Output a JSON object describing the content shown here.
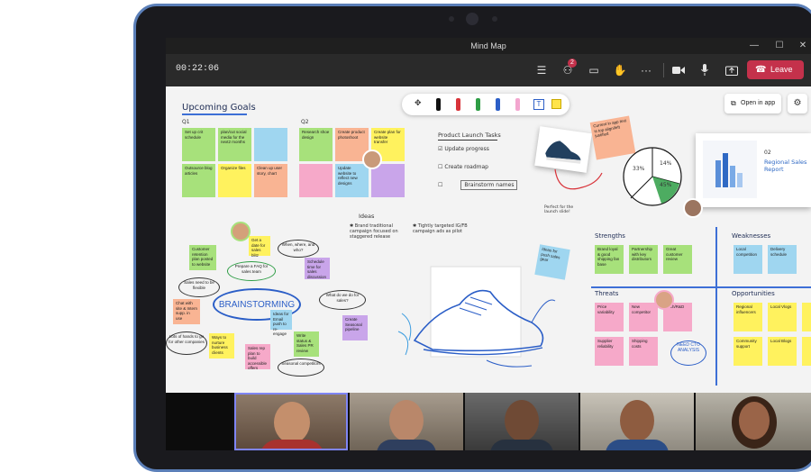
{
  "window": {
    "title": "Mind Map",
    "minimize": "—",
    "maximize": "☐",
    "close": "✕"
  },
  "toolbar": {
    "timer": "00:22:06",
    "badge_count": "2",
    "leave_label": "Leave"
  },
  "board": {
    "open_in_app": "Open in app",
    "goals": {
      "title": "Upcoming Goals",
      "q1": "Q1",
      "q2": "Q2",
      "q1_notes": [
        "Set up crit schedule",
        "plan/cut social media for the next2 months",
        "",
        "Outsource blog articles",
        "Organize files",
        "Clean up user story, chart"
      ],
      "q2_notes": [
        "Research shoe design",
        "Create product photoshoot",
        "Create plan for website transfer",
        "",
        "Update website to reflect new designs",
        ""
      ]
    },
    "tasks": {
      "title": "Product Launch Tasks",
      "items": [
        "Update progress",
        "Create roadmap",
        "Brainstorm names"
      ]
    },
    "ideas": {
      "title": "Ideas",
      "items": [
        "Brand traditional campaign focused on staggered release",
        "Tightly targeted IG/FB campaign ads as pilot"
      ]
    },
    "sticky_current": "Current in app text is top align/left justified",
    "shoe_caption": "Perfect for the launch slide!",
    "pie": {
      "labels": [
        "33%",
        "14%",
        "45%"
      ]
    },
    "report": {
      "number": "02",
      "title": "Regional Sales Report"
    },
    "brainstorm": {
      "center": "BRAINSTORMING",
      "notes": [
        "Customer retention plan posted to website",
        "Get a date for sales blitz",
        "Schedule time for sales discussion",
        "Chat with site & Intern supp. in use",
        "Ways to nurture business clients",
        "Sales rep plan to build accessible offers",
        "Write status & Sales PR review",
        "Create Seasonal pipeline",
        "Ideas for Email push to re-engage"
      ],
      "bubbles": [
        "Prepare a FAQ for sales team",
        "When, where, and who?",
        "Sales need to be flexible",
        "What do we do for sales?",
        "Lots of hands to go for other companies",
        "Seasonal competitors"
      ]
    },
    "swot": {
      "strengths": "Strengths",
      "weaknesses": "Weaknesses",
      "threats": "Threats",
      "opportunities": "Opportunities",
      "strength_notes": [
        "Brand loyal & good shipping fan base",
        "Partnership with key distributors",
        "Great customer review"
      ],
      "weakness_notes": [
        "Local competition",
        "Delivery schedule"
      ],
      "threat_notes": [
        "Price variability",
        "New competitor",
        "Tech/R&D",
        "Supplier reliability",
        "Shipping costs",
        ""
      ],
      "opportunity_notes": [
        "Regional influencers",
        "Local Vlogs",
        "",
        "Community support",
        "Local Blogs",
        ""
      ]
    },
    "need_analysis": "NEED CTO ANALYSIS",
    "blue_sticky": "Ideas for push sales gear"
  },
  "colors": {
    "leave_red": "#c4314b",
    "sticky_pink": "#f6a9c9",
    "sticky_yellow": "#fff25e",
    "sticky_green": "#a7e17b",
    "sticky_blue": "#9fd6f0",
    "sticky_purple": "#c9a5ea",
    "sticky_orange": "#f9b493",
    "ink_blue": "#3d6fd6"
  },
  "icons": [
    "list-icon",
    "people-icon",
    "chat-icon",
    "raise-hand-icon",
    "more-icon",
    "camera-icon",
    "mic-icon",
    "share-icon",
    "phone-icon",
    "gear-icon",
    "open-app-icon"
  ]
}
